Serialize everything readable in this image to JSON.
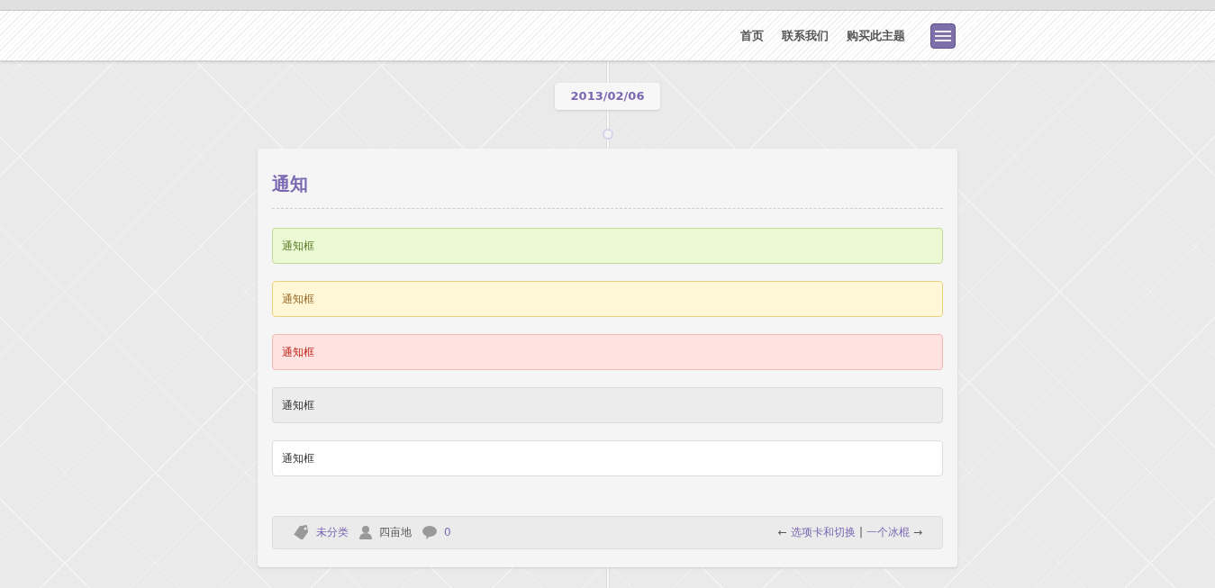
{
  "nav": {
    "items": [
      {
        "label": "首页"
      },
      {
        "label": "联系我们"
      },
      {
        "label": "购买此主题"
      }
    ]
  },
  "post": {
    "date": "2013/02/06",
    "title": "通知",
    "notices": [
      {
        "kind": "success",
        "text": "通知框"
      },
      {
        "kind": "warning",
        "text": "通知框"
      },
      {
        "kind": "error",
        "text": "通知框"
      },
      {
        "kind": "gray",
        "text": "通知框"
      },
      {
        "kind": "plain",
        "text": "通知框"
      }
    ],
    "footer": {
      "category": "未分类",
      "author": "四亩地",
      "comments": "0",
      "prev_arrow": "←",
      "prev": "选项卡和切换",
      "separator": "|",
      "next": "一个冰棍",
      "next_arrow": "→"
    }
  }
}
